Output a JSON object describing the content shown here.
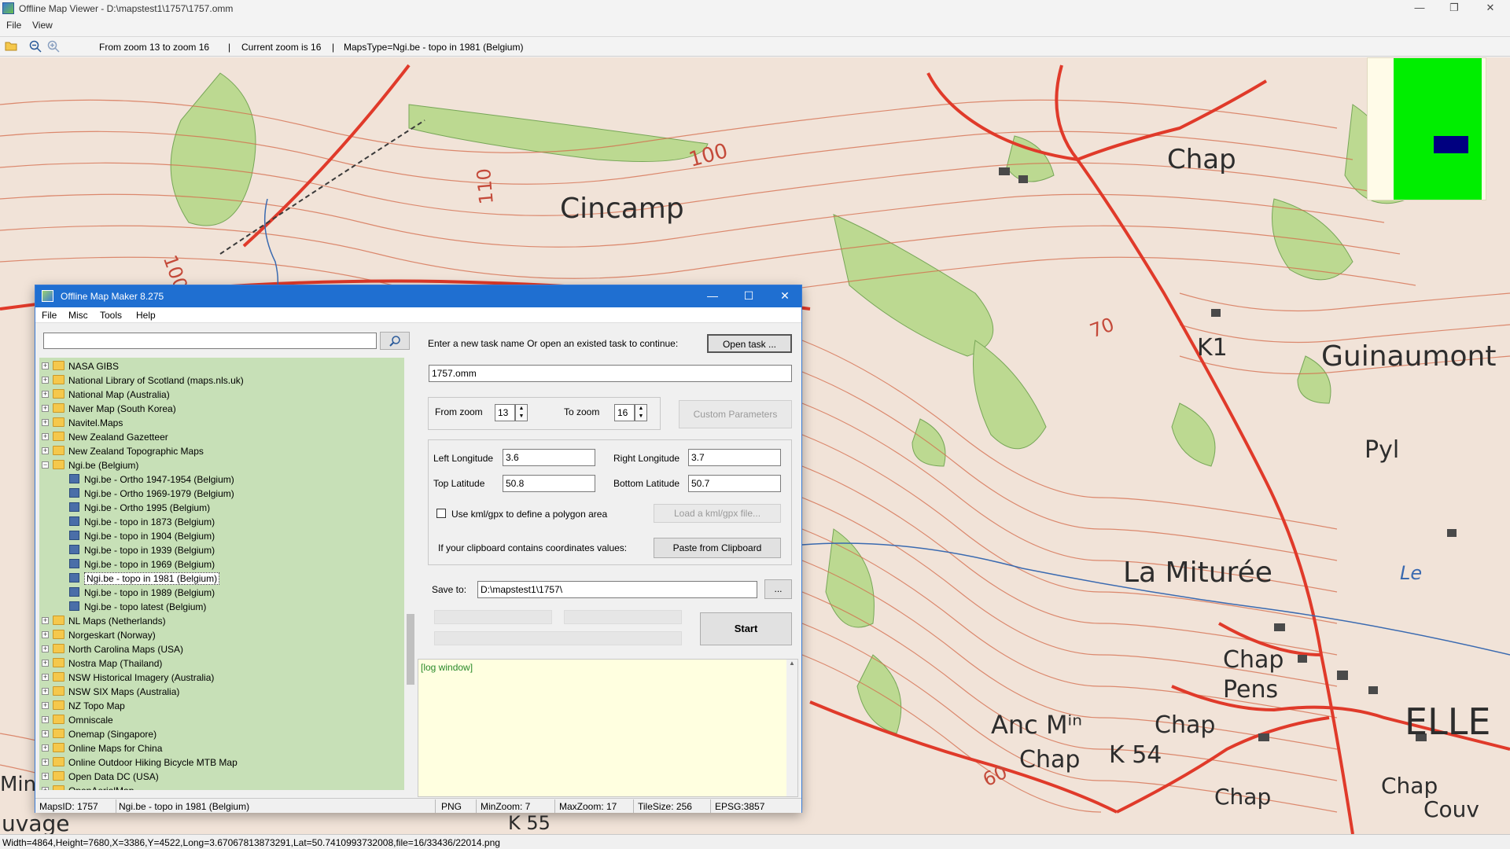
{
  "window": {
    "title": "Offline Map Viewer - D:\\mapstest1\\1757\\1757.omm",
    "minimize": "—",
    "maximize": "❐",
    "close": "✕"
  },
  "menubar": {
    "file": "File",
    "view": "View"
  },
  "toolbar": {
    "zoom_range": "From zoom 13 to zoom 16",
    "sep1": "|",
    "current_zoom": "Current zoom is 16",
    "sep2": "|",
    "maps_type": "MapsType=Ngi.be - topo in 1981 (Belgium)"
  },
  "map_labels": [
    "Cincamp",
    "Chap",
    "K1",
    "Guinaumont",
    "Pyl",
    "La Miturée",
    "Chap Pens",
    "Anc Mⁱⁿ",
    "Chap",
    "K 54",
    "Chap",
    "ELLE",
    "Chap",
    "Couv",
    "Chap",
    "uvage",
    "K 55",
    "100",
    "110",
    "100",
    "70",
    "60",
    "Le",
    "Min"
  ],
  "statusbar": {
    "info": "Width=4864,Height=7680,X=3386,Y=4522,Long=3.67067813873291,Lat=50.7410993732008,file=16/33436/22014.png"
  },
  "dialog": {
    "title": "Offline Map Maker 8.275",
    "menu": {
      "file": "File",
      "misc": "Misc",
      "tools": "Tools",
      "help": "Help"
    },
    "search": {
      "value": "",
      "placeholder": ""
    },
    "task_prompt": "Enter a new task name Or open an existed task to continue:",
    "open_task": "Open task ...",
    "task_name": "1757.omm",
    "from_zoom_label": "From zoom",
    "from_zoom": "13",
    "to_zoom_label": "To zoom",
    "to_zoom": "16",
    "custom_params": "Custom Parameters",
    "left_lon_label": "Left Longitude",
    "left_lon": "3.6",
    "right_lon_label": "Right Longitude",
    "right_lon": "3.7",
    "top_lat_label": "Top Latitude",
    "top_lat": "50.8",
    "bottom_lat_label": "Bottom Latitude",
    "bottom_lat": "50.7",
    "kml_label": "Use kml/gpx to define a polygon area",
    "load_kml": "Load a kml/gpx file...",
    "clipboard_label": "If your clipboard contains coordinates values:",
    "paste_clipboard": "Paste from Clipboard",
    "save_to_label": "Save to:",
    "save_to": "D:\\mapstest1\\1757\\",
    "browse": "...",
    "start": "Start",
    "log": "[log window]",
    "tree": [
      {
        "label": "NASA GIBS",
        "type": "folder",
        "expander": "+"
      },
      {
        "label": "National Library of Scotland (maps.nls.uk)",
        "type": "folder",
        "expander": "+"
      },
      {
        "label": "National Map (Australia)",
        "type": "folder",
        "expander": "+"
      },
      {
        "label": "Naver Map (South Korea)",
        "type": "folder",
        "expander": "+"
      },
      {
        "label": "Navitel.Maps",
        "type": "folder",
        "expander": "+"
      },
      {
        "label": "New Zealand Gazetteer",
        "type": "folder",
        "expander": "+"
      },
      {
        "label": "New Zealand Topographic Maps",
        "type": "folder",
        "expander": "+"
      },
      {
        "label": "Ngi.be (Belgium)",
        "type": "folder",
        "expander": "−"
      },
      {
        "label": "Ngi.be - Ortho 1947-1954 (Belgium)",
        "type": "map"
      },
      {
        "label": "Ngi.be - Ortho 1969-1979 (Belgium)",
        "type": "map"
      },
      {
        "label": "Ngi.be - Ortho 1995 (Belgium)",
        "type": "map"
      },
      {
        "label": "Ngi.be - topo in 1873 (Belgium)",
        "type": "map"
      },
      {
        "label": "Ngi.be - topo in 1904 (Belgium)",
        "type": "map"
      },
      {
        "label": "Ngi.be - topo in 1939 (Belgium)",
        "type": "map"
      },
      {
        "label": "Ngi.be - topo in 1969 (Belgium)",
        "type": "map"
      },
      {
        "label": "Ngi.be - topo in 1981 (Belgium)",
        "type": "map",
        "selected": true
      },
      {
        "label": "Ngi.be - topo in 1989 (Belgium)",
        "type": "map"
      },
      {
        "label": "Ngi.be - topo latest (Belgium)",
        "type": "map"
      },
      {
        "label": "NL Maps (Netherlands)",
        "type": "folder",
        "expander": "+"
      },
      {
        "label": "Norgeskart (Norway)",
        "type": "folder",
        "expander": "+"
      },
      {
        "label": "North Carolina Maps (USA)",
        "type": "folder",
        "expander": "+"
      },
      {
        "label": "Nostra Map (Thailand)",
        "type": "folder",
        "expander": "+"
      },
      {
        "label": "NSW Historical Imagery (Australia)",
        "type": "folder",
        "expander": "+"
      },
      {
        "label": "NSW SIX Maps (Australia)",
        "type": "folder",
        "expander": "+"
      },
      {
        "label": "NZ Topo Map",
        "type": "folder",
        "expander": "+"
      },
      {
        "label": "Omniscale",
        "type": "folder",
        "expander": "+"
      },
      {
        "label": "Onemap (Singapore)",
        "type": "folder",
        "expander": "+"
      },
      {
        "label": "Online Maps for China",
        "type": "folder",
        "expander": "+"
      },
      {
        "label": "Online Outdoor Hiking Bicycle MTB Map",
        "type": "folder",
        "expander": "+"
      },
      {
        "label": "Open Data DC (USA)",
        "type": "folder",
        "expander": "+"
      },
      {
        "label": "OpenAerialMap",
        "type": "folder",
        "expander": "+"
      }
    ],
    "status": {
      "maps_id": "MapsID: 1757",
      "map_name": "Ngi.be - topo in 1981 (Belgium)",
      "format": "PNG",
      "min_zoom": "MinZoom: 7",
      "max_zoom": "MaxZoom: 17",
      "tile_size": "TileSize: 256",
      "epsg": "EPSG:3857"
    }
  },
  "colors": {
    "map_paper": "#f1e3d8",
    "contour": "#d46a4a",
    "road": "#e03a2a",
    "wood": "#b7d88a",
    "tree_bg": "#c7e0b7",
    "log_bg": "#ffffe0",
    "overview_green": "#00ee00",
    "overview_box": "#000080",
    "dialog_title": "#1f6fd1"
  }
}
